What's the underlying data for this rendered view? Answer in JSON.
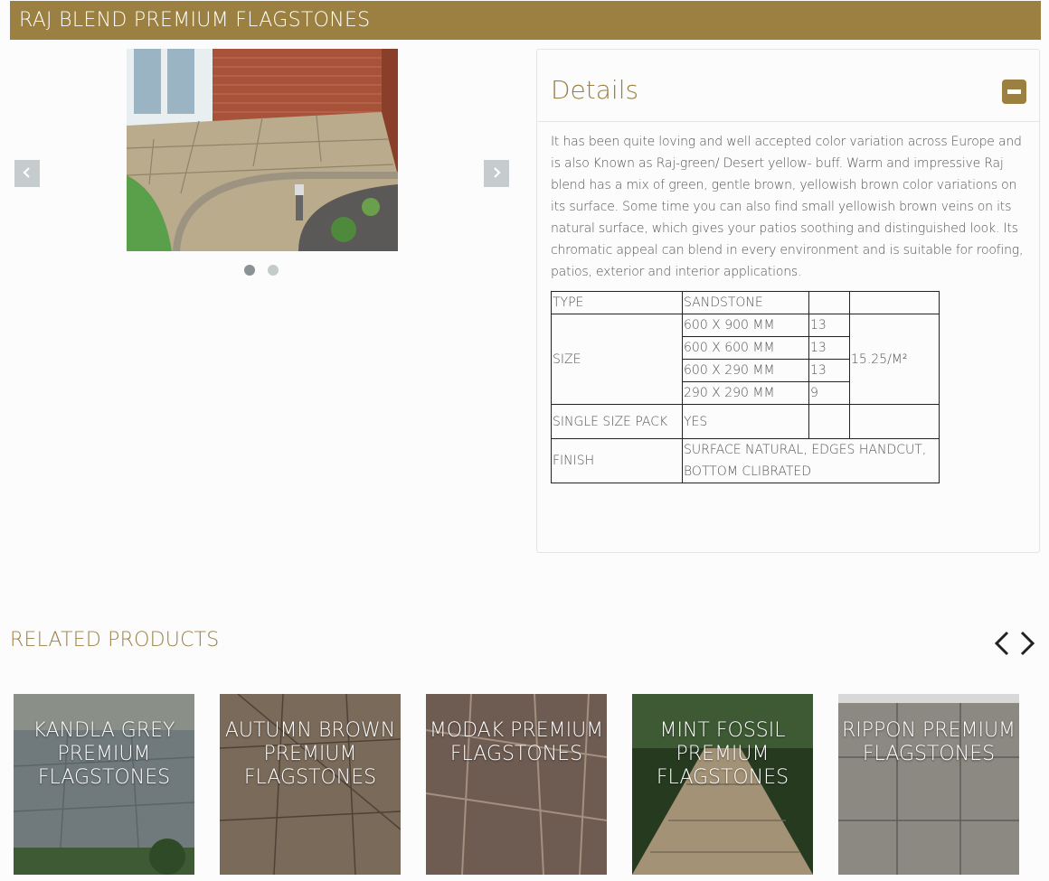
{
  "page": {
    "title": "RAJ BLEND PREMIUM FLAGSTONES"
  },
  "gallery": {
    "image_alt": "Raj blend patio",
    "prev_icon": "chevron-left-icon",
    "next_icon": "chevron-right-icon",
    "dots": 2,
    "active_dot": 1
  },
  "details": {
    "title": "Details",
    "description": "It has been quite loving and well accepted color variation across Europe and is also Known as Raj-green/ Desert yellow- buff. Warm and impressive Raj blend has a mix of green, gentle brown, yellowish brown color variations on its surface. Some time you can also find small yellowish brown veins on its natural surface, which gives your patios soothing and distinguished look. Its chromatic appeal can blend in every environment and is suitable for roofing, patios, exterior and interior applications.",
    "table": {
      "type_label": "TYPE",
      "type_value": "SANDSTONE",
      "size_label": "SIZE",
      "sizes": [
        {
          "dim": "600 X 900 MM",
          "qty": "13"
        },
        {
          "dim": "600 X 600 MM",
          "qty": "13"
        },
        {
          "dim": "600 X 290 MM",
          "qty": "13"
        },
        {
          "dim": "290 X 290 MM",
          "qty": "9"
        }
      ],
      "coverage": "15.25/M²",
      "single_label": "SINGLE SIZE PACK",
      "single_value": "YES",
      "finish_label": "FINISH",
      "finish_value": "SURFACE NATURAL, EDGES HANDCUT, BOTTOM CLIBRATED"
    }
  },
  "related": {
    "title": "RELATED PRODUCTS",
    "products": [
      {
        "name": "KANDLA GREY PREMIUM FLAGSTONES"
      },
      {
        "name": "AUTUMN BROWN PREMIUM FLAGSTONES"
      },
      {
        "name": "MODAK PREMIUM FLAGSTONES"
      },
      {
        "name": "MINT FOSSIL PREMIUM FLAGSTONES"
      },
      {
        "name": "RIPPON PREMIUM FLAGSTONES"
      }
    ]
  },
  "colors": {
    "brand": "#9b8042",
    "arrow_bg": "#c6cbce"
  }
}
